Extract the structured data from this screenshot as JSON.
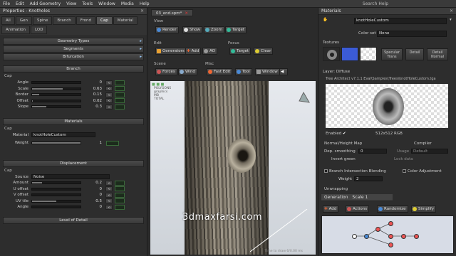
{
  "menu": [
    "File",
    "Edit",
    "Add Geometry",
    "View",
    "Tools",
    "Window",
    "Media",
    "Help"
  ],
  "search_help": "Search Help",
  "left": {
    "title": "Properties - Knotholes",
    "tabs": [
      "All",
      "Gen",
      "Spine",
      "Branch",
      "Frond",
      "Cap",
      "Material",
      "Animation",
      "LOD"
    ],
    "active_tab": "Cap",
    "sections_top": [
      "Geometry Types",
      "Segments",
      "Bifurcation"
    ],
    "branch_header": "Branch",
    "cap_label": "Cap",
    "cap_rows": [
      {
        "label": "Angle",
        "value": "0",
        "fill": 0.0
      },
      {
        "label": "Scale",
        "value": "0.63",
        "fill": 0.63
      },
      {
        "label": "Border",
        "value": "0.15",
        "fill": 0.15
      },
      {
        "label": "Offset",
        "value": "0.02",
        "fill": 0.02
      },
      {
        "label": "Slope",
        "value": "0.3",
        "fill": 0.3
      }
    ],
    "materials_header": "Materials",
    "materials_cap": "Cap",
    "material_label": "Material",
    "material_value": "knotHoleCustom",
    "weight_label": "Weight",
    "weight_value": "1",
    "displacement_header": "Displacement",
    "disp_cap": "Cap",
    "source_label": "Source",
    "source_value": "Noise",
    "disp_rows": [
      {
        "label": "Amount",
        "value": "0.2",
        "fill": 0.2
      },
      {
        "label": "U offset",
        "value": "0",
        "fill": 0.0
      },
      {
        "label": "V offset",
        "value": "0",
        "fill": 0.0
      },
      {
        "label": "UV tile",
        "value": "0.5",
        "fill": 0.5
      },
      {
        "label": "Angle",
        "value": "0",
        "fill": 0.0
      }
    ],
    "lod_header": "Level of Detail"
  },
  "center": {
    "doc_tab": "03_end.spm*",
    "view_label": "View",
    "view_buttons": [
      "Render",
      "Show",
      "Zoom",
      "Target"
    ],
    "edit_label": "Edit",
    "edit_buttons": [
      "Generators",
      "Add",
      "AO"
    ],
    "focus_label": "Focus",
    "focus_buttons": [
      "Target",
      "Clear"
    ],
    "scene_label": "Scene",
    "scene_buttons": [
      "Forces",
      "Wind"
    ],
    "misc_label": "Misc",
    "misc_buttons": [
      "Fast Edit",
      "Tool",
      "Window"
    ],
    "vp_stats": [
      "POLYGONS",
      "graphics",
      "MB",
      "TOTAL"
    ],
    "watermark": "3dmaxfarsi.com",
    "vp_footer": "Time to draw 6/0.00 ms"
  },
  "right": {
    "title": "Materials",
    "material_name": "knotHoleCustom",
    "color_set_label": "Color set",
    "color_set_value": "None",
    "textures_label": "Textures",
    "texture_slots": [
      "Specular Trans",
      "Detail",
      "Detail Normal"
    ],
    "layer_label": "Layer: Diffuse",
    "texture_path": "Tree Architect v7.1.1 Eval\\Samples\\Trees\\knotHoleCustom.tga",
    "enabled_label": "Enabled",
    "resolution": "512x512 RGB",
    "normal_height_label": "Normal/Height Map",
    "dep_smoothing_label": "Dep. smoothing",
    "dep_smoothing_value": "0",
    "invert_green_label": "Invert green",
    "compiler_label": "Compiler",
    "usage_label": "Usage",
    "usage_value": "Default",
    "lock_data_label": "Lock data",
    "branch_blending_label": "Branch Intersection Blending",
    "weight_label": "Weight",
    "weight_value": "2",
    "color_adjust_label": "Color Adjustment",
    "unwrapping_label": "Unwrapping",
    "scale_label": "Scale",
    "scale_value": "1",
    "generation_label": "Generation",
    "gen_buttons": [
      "Add",
      "Actions",
      "Randomize",
      "Simplify"
    ]
  },
  "colors": {
    "accent_red": "#e33333",
    "watermark": "#ffffff",
    "panel": "#2d2d2d"
  }
}
